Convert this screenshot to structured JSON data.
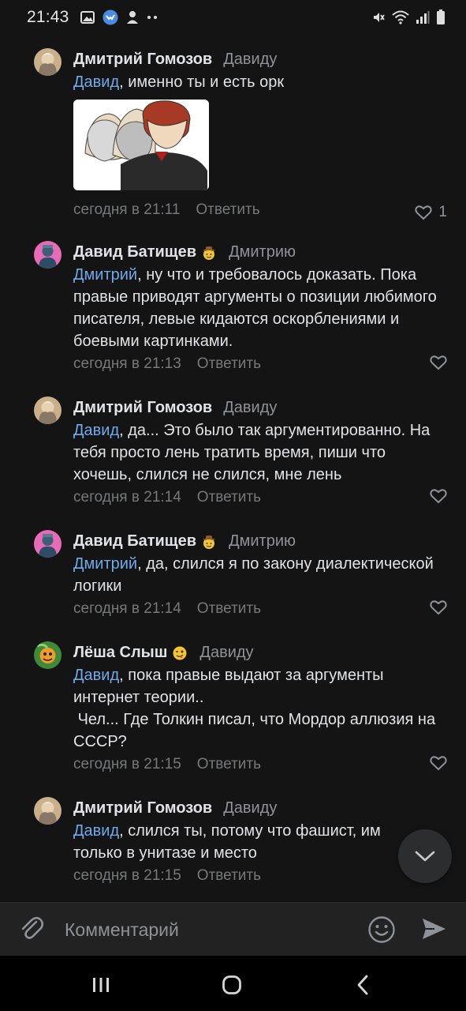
{
  "status_bar": {
    "time": "21:43"
  },
  "comments": [
    {
      "author": "Дмитрий Гомозов",
      "reply_to": "Давиду",
      "mention": "Давид",
      "text": ", именно ты и есть орк",
      "has_image": true,
      "time": "сегодня в 21:11",
      "reply_label": "Ответить",
      "likes": "1",
      "avatar": "bearded-portrait"
    },
    {
      "author": "Давид Батищев",
      "badge": "cowboy-emoji",
      "reply_to": "Дмитрию",
      "mention": "Дмитрий",
      "text": ", ну что и требовалось доказать. Пока правые приводят аргументы о позиции любимого писателя, левые кидаются оскорблениями и боевыми картинками.",
      "time": "сегодня в 21:13",
      "reply_label": "Ответить",
      "avatar": "pink-portrait"
    },
    {
      "author": "Дмитрий Гомозов",
      "reply_to": "Давиду",
      "mention": "Давид",
      "text": ", да... Это было так аргументированно. На тебя просто лень тратить время, пиши что хочешь, слился не слился, мне лень",
      "time": "сегодня в 21:14",
      "reply_label": "Ответить",
      "avatar": "bearded-portrait"
    },
    {
      "author": "Давид Батищев",
      "badge": "cowboy-emoji",
      "reply_to": "Дмитрию",
      "mention": "Дмитрий",
      "text": ", да, слился я по закону диалектической логики",
      "time": "сегодня в 21:14",
      "reply_label": "Ответить",
      "avatar": "pink-portrait"
    },
    {
      "author": "Лёша Слыш",
      "badge": "drooling-emoji",
      "reply_to": "Давиду",
      "mention": "Давид",
      "text": ", пока правые выдают за аргументы интернет теории..",
      "text2": " Чел... Где Толкин писал, что Мордор аллюзия на СССР?",
      "time": "сегодня в 21:15",
      "reply_label": "Ответить",
      "avatar": "green-cartoon"
    },
    {
      "author": "Дмитрий Гомозов",
      "reply_to": "Давиду",
      "mention": "Давид",
      "text": ", слился ты, потому что фашист, им только в унитазе и место",
      "time": "сегодня в 21:15",
      "reply_label": "Ответить",
      "avatar": "bearded-portrait"
    }
  ],
  "composer": {
    "placeholder": "Комментарий"
  },
  "icons": {
    "attach": "paperclip-icon",
    "emoji": "smiley-icon",
    "send": "send-icon",
    "scroll_down": "chevron-down-icon",
    "like": "heart-icon"
  },
  "colors": {
    "background": "#141414",
    "link": "#71aaeb",
    "secondary": "#76787a"
  }
}
